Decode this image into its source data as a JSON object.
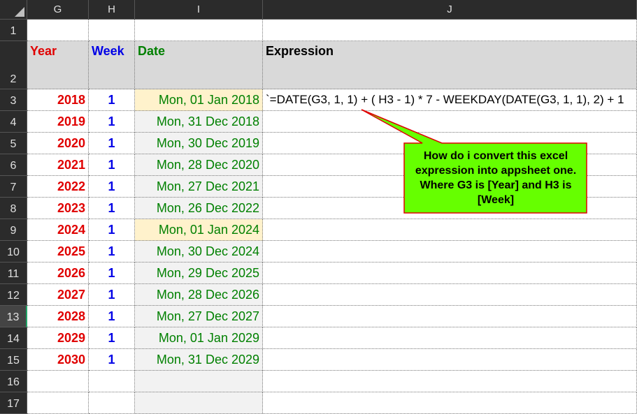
{
  "columns": [
    "G",
    "H",
    "I",
    "J"
  ],
  "rows": [
    "1",
    "2",
    "3",
    "4",
    "5",
    "6",
    "7",
    "8",
    "9",
    "10",
    "11",
    "12",
    "13",
    "14",
    "15",
    "16",
    "17"
  ],
  "headers": {
    "year": "Year",
    "week": "Week",
    "date": "Date",
    "expression": "Expression"
  },
  "expression_text": "`=DATE(G3, 1, 1) + ( H3 - 1) * 7 - WEEKDAY(DATE(G3, 1, 1), 2) + 1",
  "data_rows": [
    {
      "year": "2018",
      "week": "1",
      "date": "Mon, 01 Jan 2018"
    },
    {
      "year": "2019",
      "week": "1",
      "date": "Mon, 31 Dec 2018"
    },
    {
      "year": "2020",
      "week": "1",
      "date": "Mon, 30 Dec 2019"
    },
    {
      "year": "2021",
      "week": "1",
      "date": "Mon, 28 Dec 2020"
    },
    {
      "year": "2022",
      "week": "1",
      "date": "Mon, 27 Dec 2021"
    },
    {
      "year": "2023",
      "week": "1",
      "date": "Mon, 26 Dec 2022"
    },
    {
      "year": "2024",
      "week": "1",
      "date": "Mon, 01 Jan 2024"
    },
    {
      "year": "2025",
      "week": "1",
      "date": "Mon, 30 Dec 2024"
    },
    {
      "year": "2026",
      "week": "1",
      "date": "Mon, 29 Dec 2025"
    },
    {
      "year": "2027",
      "week": "1",
      "date": "Mon, 28 Dec 2026"
    },
    {
      "year": "2028",
      "week": "1",
      "date": "Mon, 27 Dec 2027"
    },
    {
      "year": "2029",
      "week": "1",
      "date": "Mon, 01 Jan 2029"
    },
    {
      "year": "2030",
      "week": "1",
      "date": "Mon, 31 Dec 2029"
    }
  ],
  "callout_text": "How do i convert this excel expression into appsheet one. Where G3 is [Year] and H3 is [Week]",
  "colors": {
    "year": "#e00000",
    "week": "#0000e6",
    "date": "#008000",
    "callout_fill": "#66ff00",
    "callout_border": "#e00000",
    "date_highlight": "#fff2cc"
  }
}
